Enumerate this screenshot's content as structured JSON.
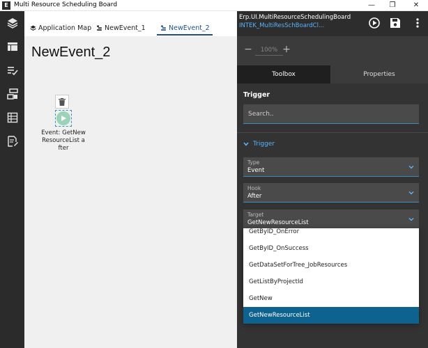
{
  "window": {
    "app_icon": "E",
    "title": "Multi Resource Scheduling Board",
    "minimize_glyph": "—",
    "maximize_glyph": "❐",
    "close_glyph": "✕"
  },
  "rail": {
    "items": [
      {
        "icon": "layers-icon"
      },
      {
        "icon": "layout-icon"
      },
      {
        "icon": "checklist-icon"
      },
      {
        "icon": "workflow-icon"
      },
      {
        "icon": "grid-icon"
      },
      {
        "icon": "document-edit-icon"
      }
    ]
  },
  "tabs": [
    {
      "label": "Application Map",
      "icon": "layers-icon"
    },
    {
      "label": "NewEvent_1",
      "icon": "event-icon"
    },
    {
      "label": "NewEvent_2",
      "icon": "event-icon",
      "active": true
    }
  ],
  "canvas": {
    "title": "NewEvent_2",
    "node_label": "Event: GetNewResourceList after"
  },
  "right_panel": {
    "header_title": "Erp.UI.MultiResourceSchedulingBoard",
    "header_subtitle": "INTEK_MultiResSchBoardCl...",
    "zoom": {
      "minus": "−",
      "value": "100%",
      "plus": "+"
    },
    "tabs": {
      "toolbox": "Toolbox",
      "properties": "Properties"
    },
    "trigger_heading": "Trigger",
    "search_placeholder": "Search..",
    "collapse_label": "Trigger",
    "fields": {
      "type": {
        "label": "Type",
        "value": "Event"
      },
      "hook": {
        "label": "Hook",
        "value": "After"
      },
      "target": {
        "label": "Target",
        "value": "GetNewResourceList"
      }
    }
  },
  "dropdown": {
    "options": [
      {
        "label": "GetByID_OnError"
      },
      {
        "label": "GetByID_OnSuccess"
      },
      {
        "label": "GetDataSetForTree_JobResources"
      },
      {
        "label": "GetListByProjectId"
      },
      {
        "label": "GetNew"
      },
      {
        "label": "GetNewResourceList",
        "selected": true
      }
    ]
  },
  "colors": {
    "accent": "#5ab4ff",
    "selected": "#0e6290",
    "rail_bg": "#2b2b2b",
    "panel_bg": "#333333",
    "node_green": "#9ad3b8"
  }
}
